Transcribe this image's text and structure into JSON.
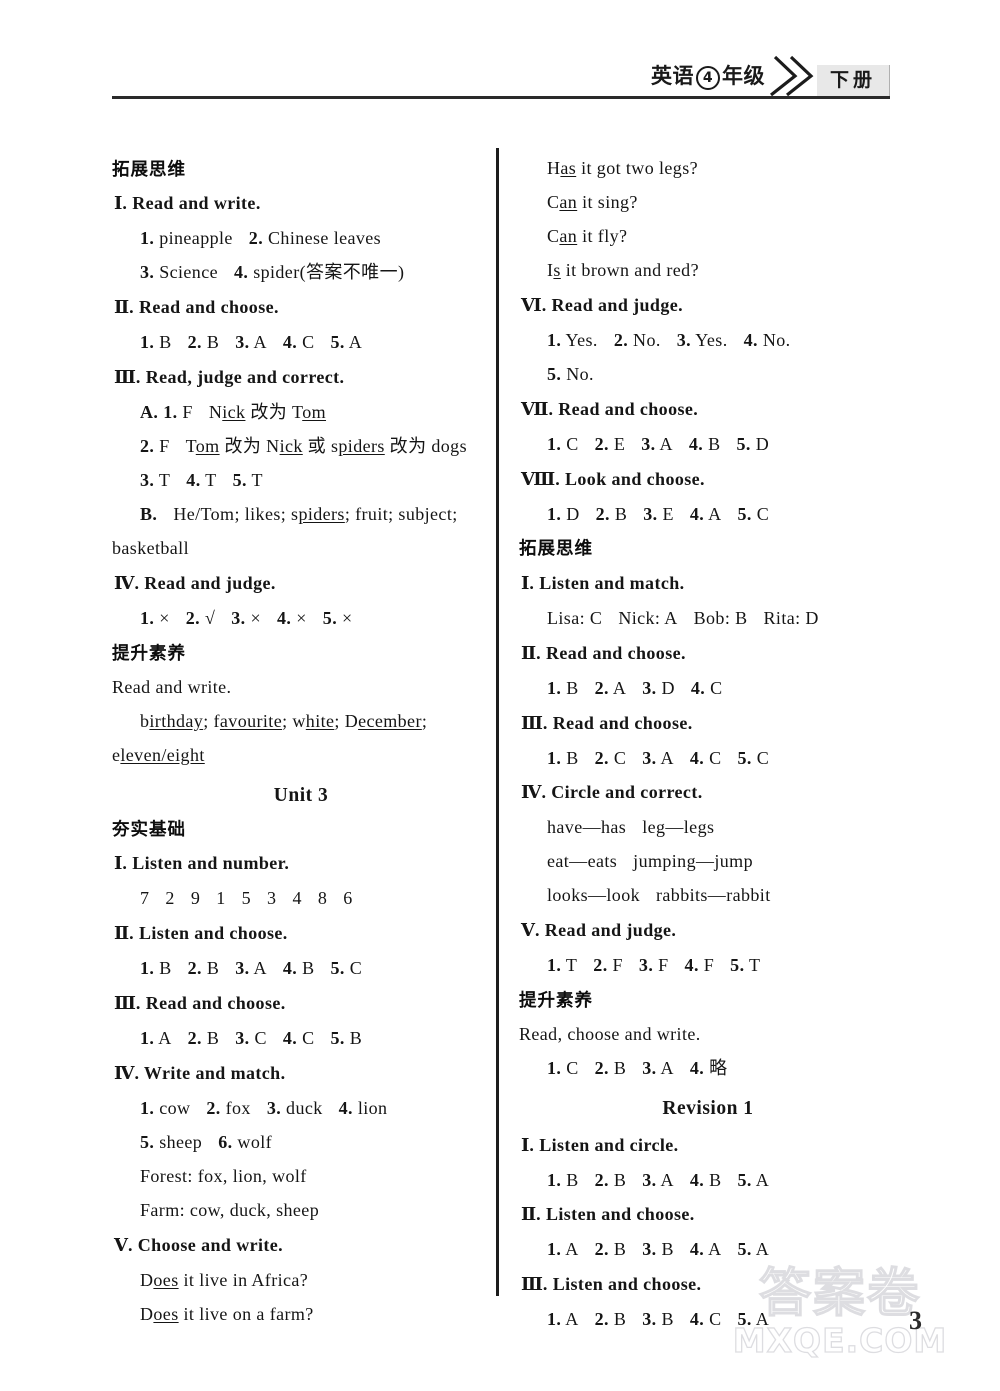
{
  "header": {
    "subject": "英语",
    "grade_number": "4",
    "grade_word": "年级",
    "chevron_icon": "double-chevron-right-icon",
    "term": "下册"
  },
  "footer": {
    "page_number": "3",
    "watermark_cn": "答案卷",
    "watermark_en": "MXQE.COM"
  },
  "left_column": {
    "blocks": [
      {
        "kind": "cn-head",
        "text": "拓展思维"
      },
      {
        "kind": "ex-title",
        "numeral": "Ⅰ",
        "text": ". Read and write."
      },
      {
        "kind": "ans",
        "text": "1. pineapple   2. Chinese leaves"
      },
      {
        "kind": "ans",
        "text": "3. Science   4. spider(答案不唯一)"
      },
      {
        "kind": "ex-title",
        "numeral": "Ⅱ",
        "text": ". Read and choose."
      },
      {
        "kind": "ans",
        "text": "1. B  2. B  3. A  4. C  5. A"
      },
      {
        "kind": "ex-title",
        "numeral": "Ⅲ",
        "text": ". Read, judge and correct."
      },
      {
        "kind": "ans",
        "text": "A. 1. F   Nick 改为 Tom"
      },
      {
        "kind": "ans",
        "text": "2. F   Tom 改为 Nick 或 spiders 改为 dogs"
      },
      {
        "kind": "ans",
        "text": "3. T  4. T  5. T"
      },
      {
        "kind": "ans",
        "text": "B.  He/Tom; likes; spiders; fruit; subject;"
      },
      {
        "kind": "plain",
        "text": "basketball"
      },
      {
        "kind": "ex-title",
        "numeral": "Ⅳ",
        "text": ". Read and judge."
      },
      {
        "kind": "ans",
        "text": "1. ×  2. √  3. ×  4. ×  5. ×"
      },
      {
        "kind": "cn-head",
        "text": "提升素养"
      },
      {
        "kind": "plain",
        "text": "Read and write."
      },
      {
        "kind": "ans",
        "text": "birthday; favourite; white; December;"
      },
      {
        "kind": "plain",
        "text": "eleven/eight"
      },
      {
        "kind": "unit",
        "text": "Unit 3"
      },
      {
        "kind": "cn-head",
        "text": "夯实基础"
      },
      {
        "kind": "ex-title",
        "numeral": "Ⅰ",
        "text": ". Listen and number."
      },
      {
        "kind": "ans",
        "text": "7  2  9    1  5  3    4  8  6"
      },
      {
        "kind": "ex-title",
        "numeral": "Ⅱ",
        "text": ". Listen and choose."
      },
      {
        "kind": "ans",
        "text": "1. B  2. B  3. A  4. B  5. C"
      },
      {
        "kind": "ex-title",
        "numeral": "Ⅲ",
        "text": ". Read and choose."
      },
      {
        "kind": "ans",
        "text": "1. A  2. B  3. C  4. C  5. B"
      },
      {
        "kind": "ex-title",
        "numeral": "Ⅳ",
        "text": ". Write and match."
      },
      {
        "kind": "ans",
        "text": "1. cow   2. fox   3. duck   4. lion"
      },
      {
        "kind": "ans",
        "text": "5. sheep   6. wolf"
      },
      {
        "kind": "ans",
        "text": "Forest: fox, lion, wolf"
      },
      {
        "kind": "ans",
        "text": "Farm: cow, duck, sheep"
      },
      {
        "kind": "ex-title",
        "numeral": "Ⅴ",
        "text": ". Choose and write."
      },
      {
        "kind": "ans",
        "text": "Does it live in Africa?"
      },
      {
        "kind": "ans",
        "text": "Does it live on a farm?"
      }
    ]
  },
  "right_column": {
    "blocks": [
      {
        "kind": "ans",
        "text": "Has it got two legs?"
      },
      {
        "kind": "ans",
        "text": "Can it sing?"
      },
      {
        "kind": "ans",
        "text": "Can it fly?"
      },
      {
        "kind": "ans",
        "text": "Is it brown and red?"
      },
      {
        "kind": "ex-title",
        "numeral": "Ⅵ",
        "text": ". Read and judge."
      },
      {
        "kind": "ans",
        "text": "1. Yes.   2. No.   3. Yes.   4. No."
      },
      {
        "kind": "ans",
        "text": "5. No."
      },
      {
        "kind": "ex-title",
        "numeral": "Ⅶ",
        "text": ". Read and choose."
      },
      {
        "kind": "ans",
        "text": "1. C  2. E  3. A  4. B  5. D"
      },
      {
        "kind": "ex-title",
        "numeral": "Ⅷ",
        "text": ". Look and choose."
      },
      {
        "kind": "ans",
        "text": "1. D  2. B  3. E  4. A  5. C"
      },
      {
        "kind": "cn-head",
        "text": "拓展思维"
      },
      {
        "kind": "ex-title",
        "numeral": "Ⅰ",
        "text": ". Listen and match."
      },
      {
        "kind": "ans",
        "text": "Lisa: C   Nick: A   Bob: B   Rita: D"
      },
      {
        "kind": "ex-title",
        "numeral": "Ⅱ",
        "text": ". Read and choose."
      },
      {
        "kind": "ans",
        "text": "1. B  2. A  3. D  4. C"
      },
      {
        "kind": "ex-title",
        "numeral": "Ⅲ",
        "text": ". Read and choose."
      },
      {
        "kind": "ans",
        "text": "1. B  2. C  3. A  4. C  5. C"
      },
      {
        "kind": "ex-title",
        "numeral": "Ⅳ",
        "text": ". Circle and correct."
      },
      {
        "kind": "ans",
        "text": "have—has   leg—legs"
      },
      {
        "kind": "ans",
        "text": "eat—eats   jumping—jump"
      },
      {
        "kind": "ans",
        "text": "looks—look   rabbits—rabbit"
      },
      {
        "kind": "ex-title",
        "numeral": "Ⅴ",
        "text": ". Read and judge."
      },
      {
        "kind": "ans",
        "text": "1. T  2. F  3. F  4. F  5. T"
      },
      {
        "kind": "cn-head",
        "text": "提升素养"
      },
      {
        "kind": "plain",
        "text": "Read, choose and write."
      },
      {
        "kind": "ans",
        "text": "1. C  2. B  3. A  4. 略"
      },
      {
        "kind": "unit",
        "text": "Revision 1"
      },
      {
        "kind": "ex-title",
        "numeral": "Ⅰ",
        "text": ". Listen and circle."
      },
      {
        "kind": "ans",
        "text": "1. B  2. B  3. A  4. B  5. A"
      },
      {
        "kind": "ex-title",
        "numeral": "Ⅱ",
        "text": ". Listen and choose."
      },
      {
        "kind": "ans",
        "text": "1. A  2. B  3. B  4. A  5. A"
      },
      {
        "kind": "ex-title",
        "numeral": "Ⅲ",
        "text": ". Listen and choose."
      },
      {
        "kind": "ans",
        "text": "1. A  2. B  3. B  4. C  5. A"
      }
    ]
  }
}
